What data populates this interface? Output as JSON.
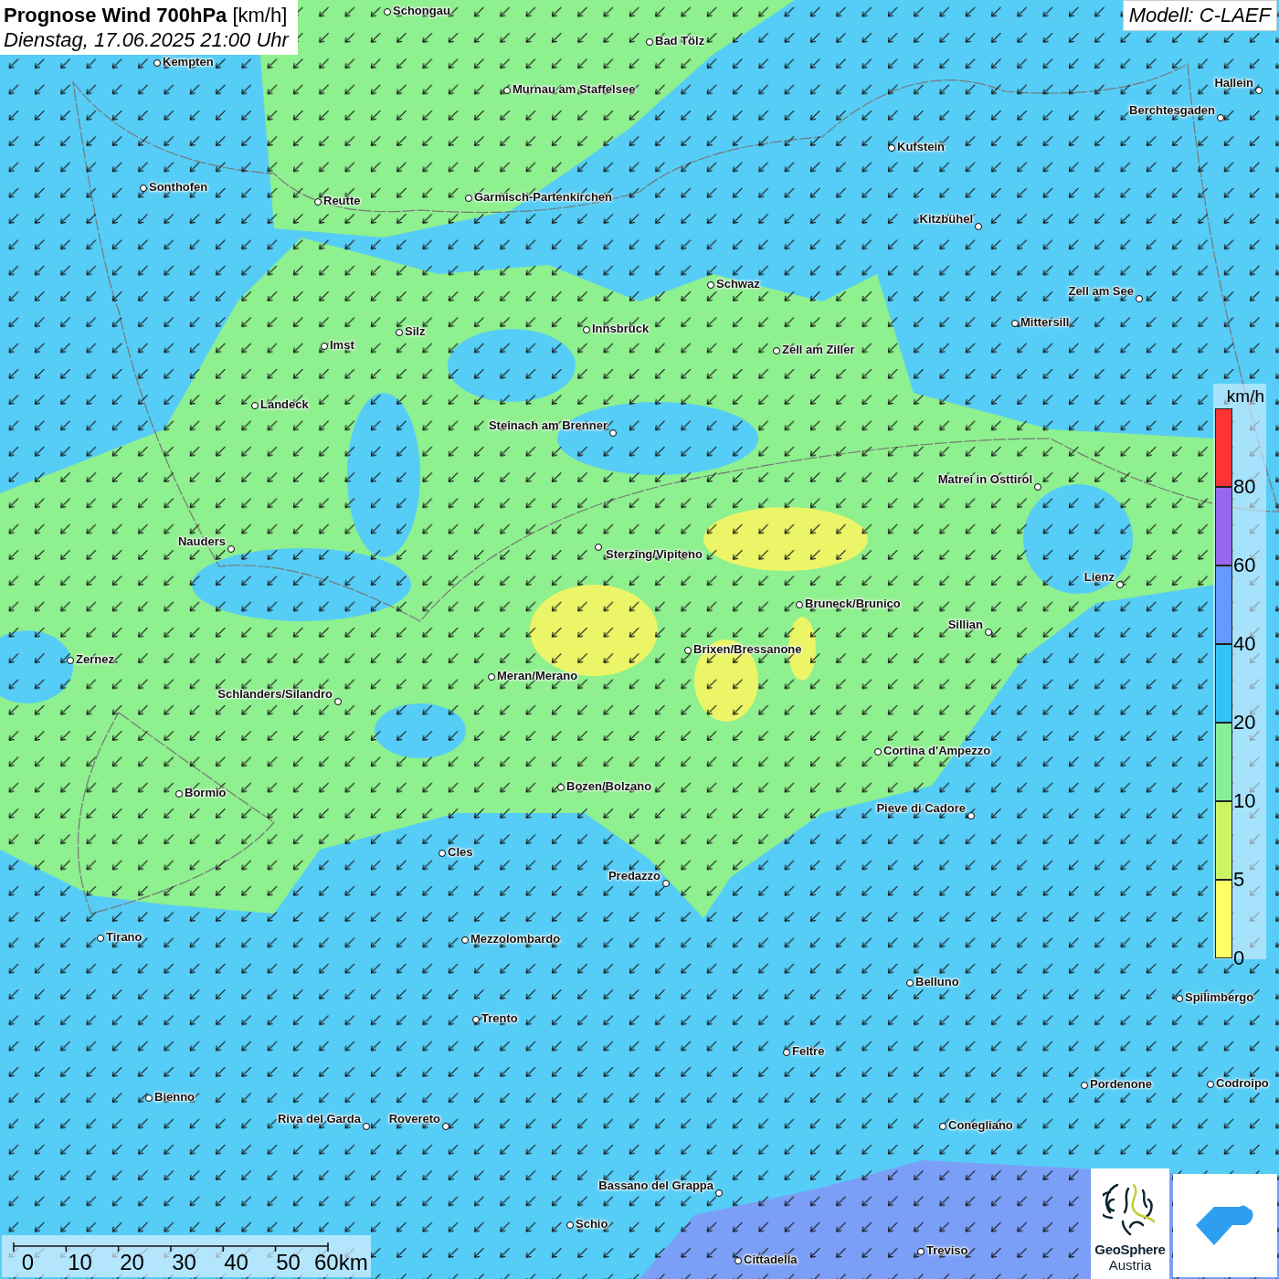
{
  "header": {
    "title": "**Prognose Wind 700hPa** [km/h]",
    "subtitle": "Dienstag, 17.06.2025 21:00 Uhr"
  },
  "model": "Modell: C-LAEF",
  "cities": [
    {
      "name": "Schongau"
    },
    {
      "name": "Bad Tölz"
    },
    {
      "name": "Kempten"
    },
    {
      "name": "Murnau am Staffelsee"
    },
    {
      "name": "Hallein"
    },
    {
      "name": "Berchtesgaden"
    },
    {
      "name": "Kufstein"
    },
    {
      "name": "Sonthofen"
    },
    {
      "name": "Reutte"
    },
    {
      "name": "Garmisch-Partenkirchen"
    },
    {
      "name": "Kitzbühel"
    },
    {
      "name": "Schwaz"
    },
    {
      "name": "Zell am See"
    },
    {
      "name": "Mittersill"
    },
    {
      "name": "Innsbruck"
    },
    {
      "name": "Imst"
    },
    {
      "name": "Silz"
    },
    {
      "name": "Zell am Ziller"
    },
    {
      "name": "Landeck"
    },
    {
      "name": "Steinach am Brenner"
    },
    {
      "name": "Matrei in Osttirol"
    },
    {
      "name": "Nauders"
    },
    {
      "name": "Sterzing/Vipiteno"
    },
    {
      "name": "Lienz"
    },
    {
      "name": "Bruneck/Brunico"
    },
    {
      "name": "Sillian"
    },
    {
      "name": "Brixen/Bressanone"
    },
    {
      "name": "Zernez"
    },
    {
      "name": "Meran/Merano"
    },
    {
      "name": "Schlanders/Silandro"
    },
    {
      "name": "Cortina d'Ampezzo"
    },
    {
      "name": "Bozen/Bolzano"
    },
    {
      "name": "Bormio"
    },
    {
      "name": "Pieve di Cadore"
    },
    {
      "name": "Cles"
    },
    {
      "name": "Predazzo"
    },
    {
      "name": "Tirano"
    },
    {
      "name": "Mezzolombardo"
    },
    {
      "name": "Belluno"
    },
    {
      "name": "Spilimbergo"
    },
    {
      "name": "Trento"
    },
    {
      "name": "Feltre"
    },
    {
      "name": "Pordenone"
    },
    {
      "name": "Codroipo"
    },
    {
      "name": "Bienno"
    },
    {
      "name": "Riva del Garda"
    },
    {
      "name": "Rovereto"
    },
    {
      "name": "Conegliano"
    },
    {
      "name": "Bassano del Grappa"
    },
    {
      "name": "Schio"
    },
    {
      "name": "Treviso"
    },
    {
      "name": "Cittadella"
    }
  ],
  "legend": {
    "unit": "km/h",
    "segments": [
      {
        "label": "80",
        "color": "#ff3333"
      },
      {
        "label": "60",
        "color": "#9966ee"
      },
      {
        "label": "40",
        "color": "#6699ff"
      },
      {
        "label": "20",
        "color": "#33c4f5"
      },
      {
        "label": "10",
        "color": "#88ee99"
      },
      {
        "label": "5",
        "color": "#ccf566"
      },
      {
        "label": "0",
        "color": "#ffff66"
      }
    ]
  },
  "scale": {
    "ticks": [
      "0",
      "10",
      "20",
      "30",
      "40",
      "50",
      "60km"
    ]
  },
  "logos": {
    "geosphere_line1": "GeoSphere",
    "geosphere_line2": "Austria"
  }
}
